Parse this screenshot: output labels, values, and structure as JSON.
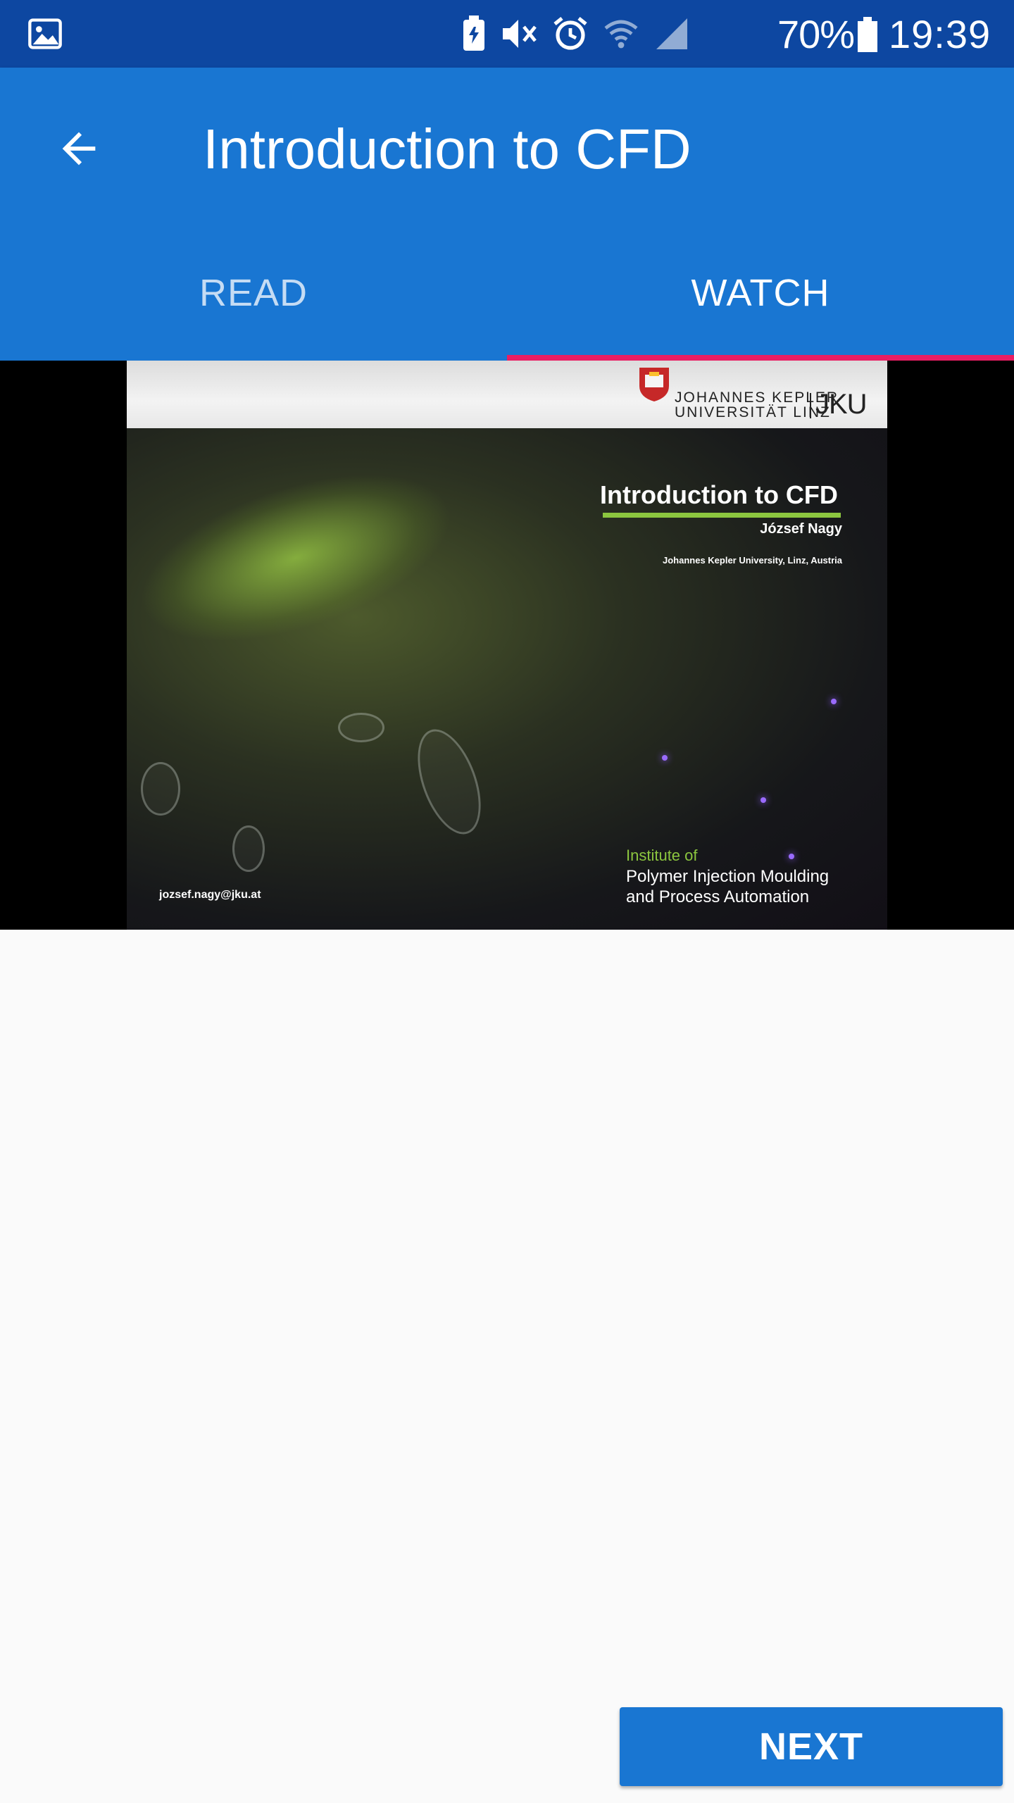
{
  "status_bar": {
    "left_icon": "image-icon",
    "icons": [
      "battery-saver-icon",
      "mute-vibrate-icon",
      "alarm-icon",
      "wifi-icon",
      "signal-icon"
    ],
    "battery_percent": "70%",
    "time": "19:39"
  },
  "app_bar": {
    "back_icon": "arrow-back-icon",
    "title": "Introduction to CFD"
  },
  "tabs": [
    {
      "label": "READ",
      "selected": false
    },
    {
      "label": "WATCH",
      "selected": true
    }
  ],
  "video_slide": {
    "university_name_line1": "JOHANNES KEPLER",
    "university_name_line2": "UNIVERSITÄT LINZ",
    "university_short": "JKU",
    "title": "Introduction to CFD",
    "author": "József Nagy",
    "affiliation": "Johannes Kepler University, Linz, Austria",
    "institute_line1": "Institute of",
    "institute_line2": "Polymer Injection Moulding",
    "institute_line3": "and Process Automation",
    "email": "jozsef.nagy@jku.at"
  },
  "footer": {
    "next_label": "NEXT"
  },
  "colors": {
    "status_bar": "#0d47a1",
    "primary": "#1976d2",
    "tab_indicator": "#e91e63",
    "slide_accent": "#8cc63f",
    "background": "#fafafa"
  }
}
